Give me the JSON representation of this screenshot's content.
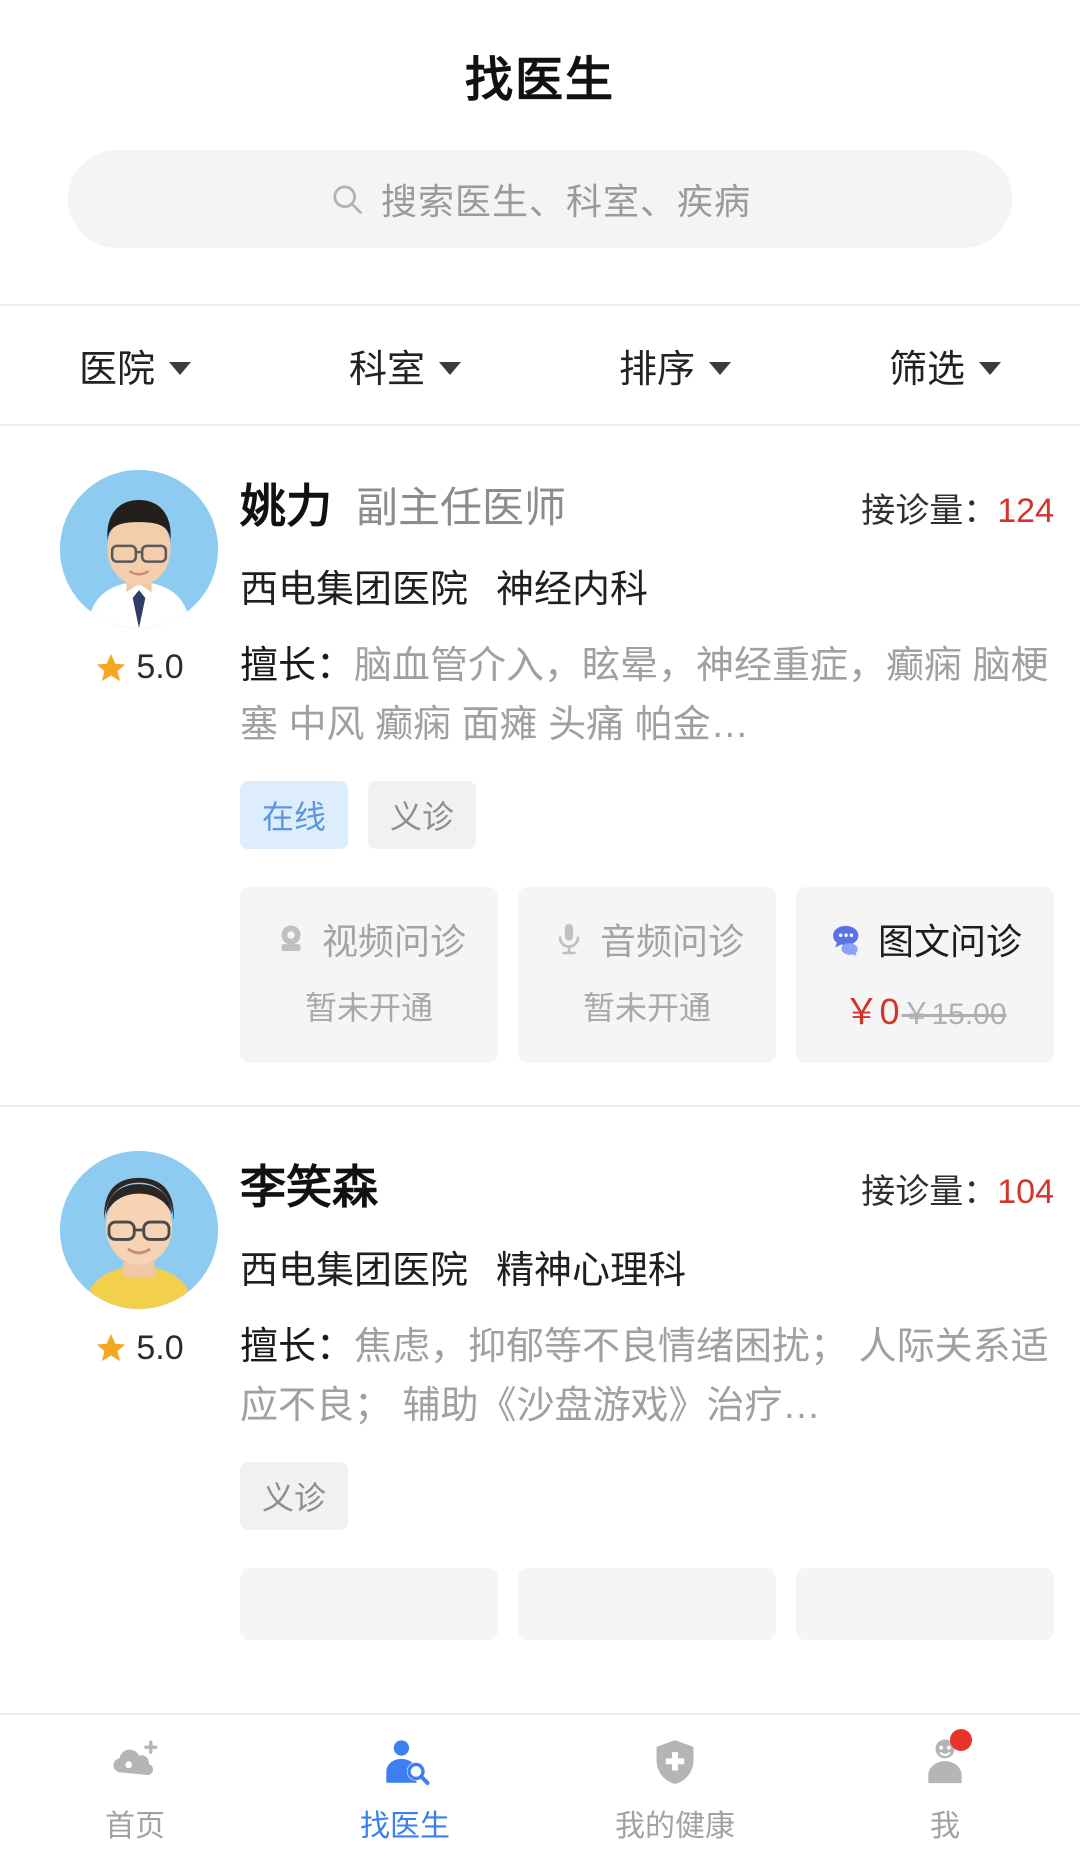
{
  "header": {
    "title": "找医生"
  },
  "search": {
    "placeholder": "搜索医生、科室、疾病",
    "icon": "search-icon"
  },
  "filters": [
    {
      "label": "医院"
    },
    {
      "label": "科室"
    },
    {
      "label": "排序"
    },
    {
      "label": "筛选"
    }
  ],
  "consult_label": "接诊量：",
  "skill_label": "擅长：",
  "doctors": [
    {
      "name": "姚力",
      "title": "副主任医师",
      "consult_count": "124",
      "hospital": "西电集团医院",
      "department": "神经内科",
      "rating": "5.0",
      "skills": "脑血管介入，眩晕，神经重症，癫痫 脑梗塞 中风 癫痫 面瘫 头痛 帕金…",
      "tags": [
        {
          "label": "在线",
          "style": "online"
        },
        {
          "label": "义诊",
          "style": "free"
        }
      ],
      "services": [
        {
          "name": "视频问诊",
          "icon": "video-camera-icon",
          "sub": "暂未开通",
          "active": false
        },
        {
          "name": "音频问诊",
          "icon": "microphone-icon",
          "sub": "暂未开通",
          "active": false
        },
        {
          "name": "图文问诊",
          "icon": "chat-bubble-icon",
          "price": "￥0",
          "price_old": "￥15.00",
          "active": true
        }
      ]
    },
    {
      "name": "李笑森",
      "title": "",
      "consult_count": "104",
      "hospital": "西电集团医院",
      "department": "精神心理科",
      "rating": "5.0",
      "skills": "焦虑，抑郁等不良情绪困扰； 人际关系适应不良； 辅助《沙盘游戏》治疗…",
      "tags": [
        {
          "label": "义诊",
          "style": "free"
        }
      ],
      "services": [
        {
          "name": "",
          "icon": "",
          "sub": "",
          "active": false
        },
        {
          "name": "",
          "icon": "",
          "sub": "",
          "active": false
        },
        {
          "name": "",
          "icon": "",
          "sub": "",
          "active": false
        }
      ]
    }
  ],
  "tabbar": [
    {
      "label": "首页",
      "icon": "home-cloud-icon",
      "active": false,
      "badge": false
    },
    {
      "label": "找医生",
      "icon": "doctor-search-icon",
      "active": true,
      "badge": false
    },
    {
      "label": "我的健康",
      "icon": "health-shield-icon",
      "active": false,
      "badge": false
    },
    {
      "label": "我",
      "icon": "person-icon",
      "active": false,
      "badge": true
    }
  ],
  "colors": {
    "accent": "#3b7ff0",
    "price_red": "#d3342c",
    "star_orange": "#f5a623",
    "tag_online_bg": "#ddedfb",
    "tag_online_text": "#5c97dd"
  }
}
